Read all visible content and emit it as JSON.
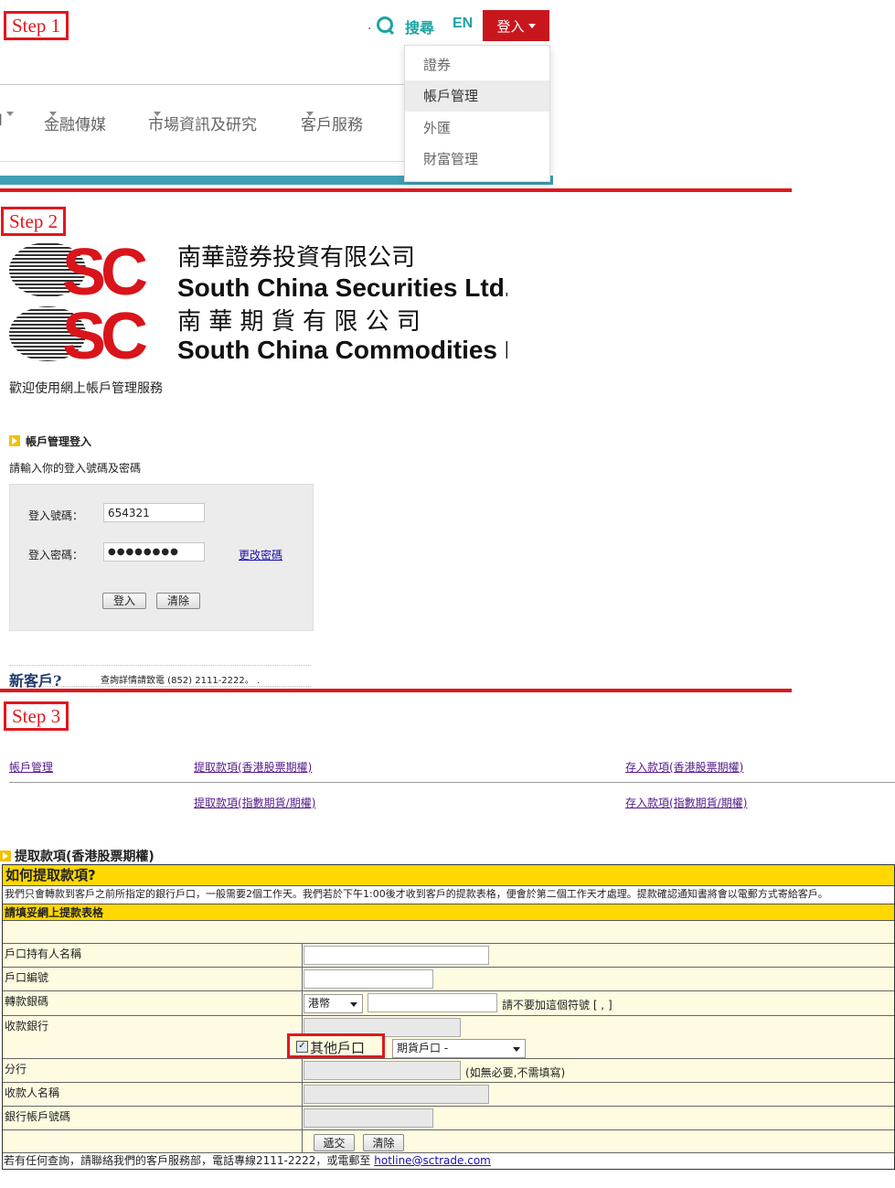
{
  "steps": {
    "s1": "Step 1",
    "s2": "Step 2",
    "s3": "Step 3"
  },
  "header": {
    "dot": ".",
    "search_label": "搜尋",
    "lang_label": "EN",
    "login_label": "登入",
    "menu": [
      "證券",
      "帳戶管理",
      "外匯",
      "財富管理"
    ],
    "nav": [
      "金融傳媒",
      "市場資訊及研究",
      "客戶服務"
    ]
  },
  "logo": {
    "line1": "南華證券投資有限公司",
    "line2": "South China Securities Ltd.",
    "line3": "南 華 期 貨 有 限 公 司",
    "line4": "South China Commodities Ltd."
  },
  "login": {
    "welcome": "歡迎使用網上帳戶管理服務",
    "title": "帳戶管理登入",
    "instruction": "請輸入你的登入號碼及密碼",
    "id_label": "登入號碼：",
    "id_value": "654321",
    "pw_label": "登入密碼：",
    "pw_value": "●●●●●●●●",
    "change_pw": "更改密碼",
    "submit": "登入",
    "clear": "清除",
    "new_client": "新客戶?",
    "new_client_info": "查詢詳情請致電 (852) 2111-2222。  ."
  },
  "links": {
    "account_mgmt": "帳戶管理",
    "withdraw_hk": "提取款項(香港股票期權)",
    "deposit_hk": "存入款項(香港股票期權)",
    "withdraw_idx": "提取款項(指數期貨/期權)",
    "deposit_idx": "存入款項(指數期貨/期權)"
  },
  "form": {
    "title": "提取款項(香港股票期權)",
    "how_title": "如何提取款項?",
    "description": "我們只會轉款到客戶之前所指定的銀行戶口，一般需要2個工作天。我們若於下午1:00後才收到客戶的提款表格，便會於第二個工作天才處理。提款確認通知書將會以電郵方式寄給客戶。",
    "subtitle": "請填妥網上提款表格",
    "holder_label": "戶口持有人名稱",
    "account_label": "戶口編號",
    "amount_label": "轉款銀碼",
    "currency": "港幣",
    "amount_note": "請不要加這個符號 [ , ]",
    "bank_label": "收款銀行",
    "other_account": "其他戶口",
    "account_type": "期貨戶口 -",
    "branch_label": "分行",
    "branch_note": "(如無必要,不需填寫)",
    "payee_label": "收款人名稱",
    "bank_account_label": "銀行帳戶號碼",
    "submit": "遞交",
    "clear": "清除",
    "footer_text": "若有任何查詢，請聯絡我們的客戶服務部，電話專線2111-2222，或電郵至",
    "footer_email": "hotline@sctrade.com"
  }
}
